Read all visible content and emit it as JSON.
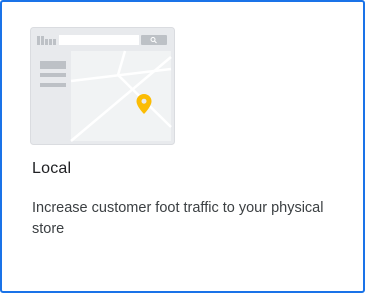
{
  "card": {
    "title": "Local",
    "description": "Increase customer foot traffic to your physical store",
    "selected": true,
    "border_color": "#1a73e8",
    "illustration": {
      "icon": "map-browser-illustration",
      "pin_color": "#fbbc04"
    }
  }
}
